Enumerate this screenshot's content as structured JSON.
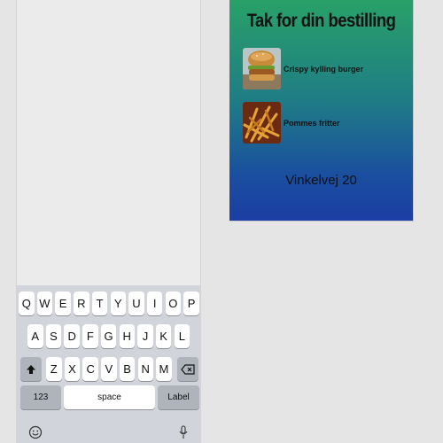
{
  "keyboard": {
    "row1": [
      "Q",
      "W",
      "E",
      "R",
      "T",
      "Y",
      "U",
      "I",
      "O",
      "P"
    ],
    "row2": [
      "A",
      "S",
      "D",
      "F",
      "G",
      "H",
      "J",
      "K",
      "L"
    ],
    "row3": [
      "Z",
      "X",
      "C",
      "V",
      "B",
      "N",
      "M"
    ],
    "numbers_label": "123",
    "space_label": "space",
    "return_label": "Label",
    "icons": {
      "shift": "shift-icon",
      "backspace": "backspace-icon",
      "emoji": "emoji-icon",
      "mic": "microphone-icon"
    }
  },
  "order": {
    "title": "Tak for din bestilling",
    "items": [
      {
        "name": "Crispy kylling burger",
        "image": "burger-image"
      },
      {
        "name": "Pommes fritter",
        "image": "fries-image"
      }
    ],
    "address": "Vinkelvej 20"
  },
  "colors": {
    "gradient_top": "#28a168",
    "gradient_bottom": "#1b3ea4",
    "page_background": "#e5e5e5",
    "keyboard_background": "#d1d4da"
  }
}
